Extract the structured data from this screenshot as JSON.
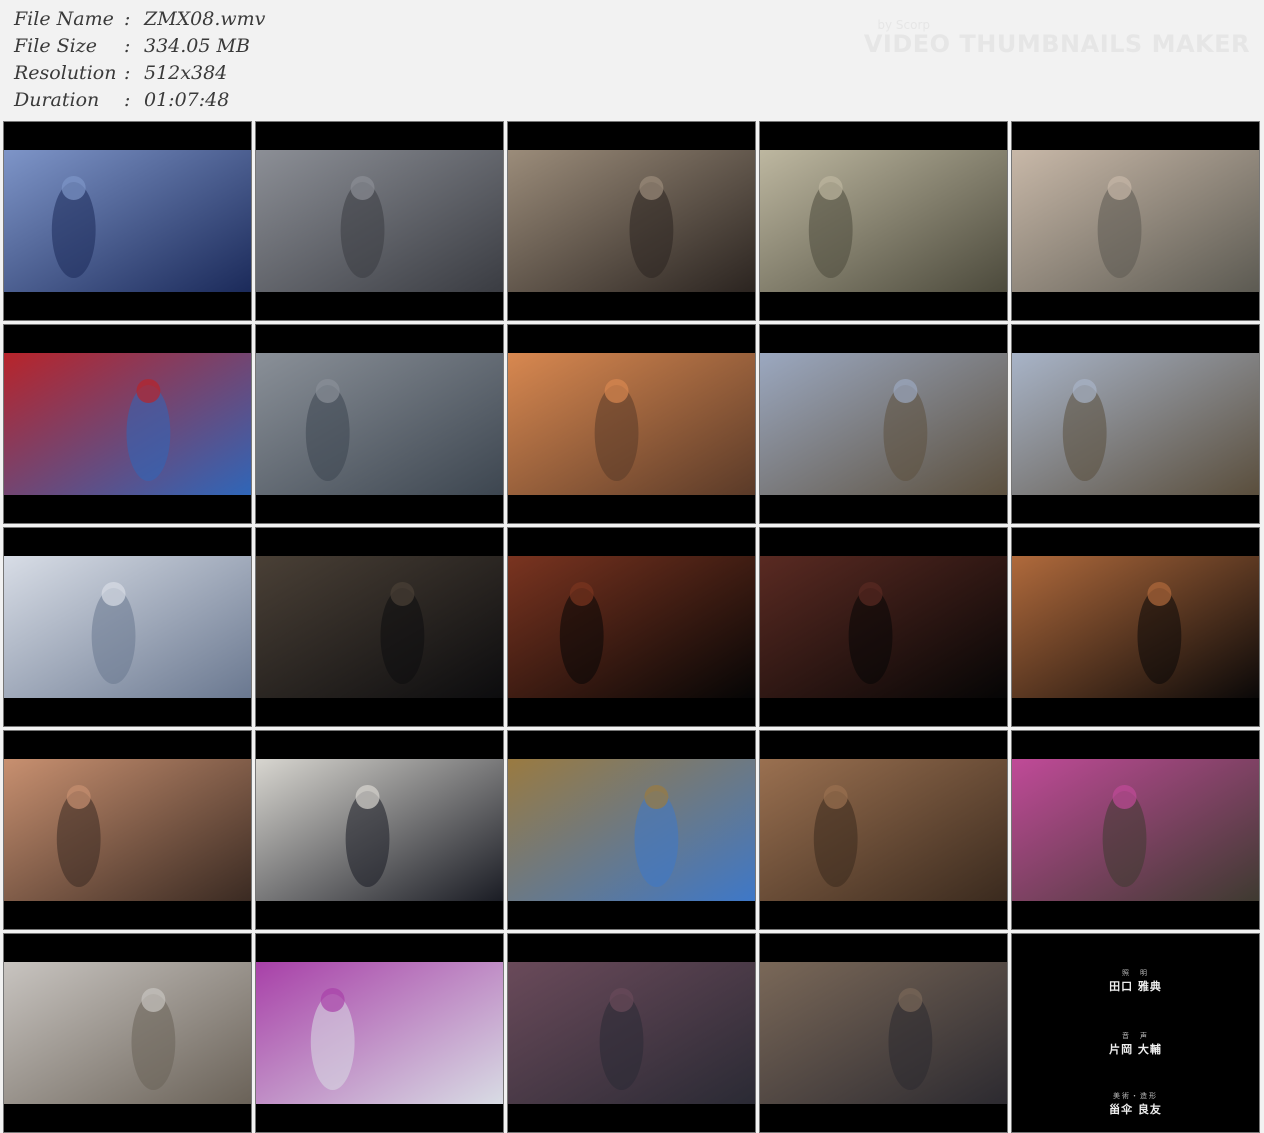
{
  "info": {
    "rows": [
      {
        "key": "File Name",
        "sep": ":",
        "value": "ZMX08.wmv"
      },
      {
        "key": "File Size",
        "sep": ":",
        "value": "334.05 MB"
      },
      {
        "key": "Resolution",
        "sep": ":",
        "value": "512x384"
      },
      {
        "key": "Duration",
        "sep": ":",
        "value": "01:07:48"
      }
    ]
  },
  "watermark": {
    "by": "by Scorp",
    "title": "VIDEO THUMBNAILS MAKER"
  },
  "thumbnails": [
    {
      "scene": "figure-in-blue-fog",
      "colors": [
        "#1b2a5a",
        "#7e95c8"
      ]
    },
    {
      "scene": "girls-in-classroom",
      "colors": [
        "#3a3c42",
        "#8c8f96"
      ]
    },
    {
      "scene": "girls-in-classroom",
      "colors": [
        "#2b2420",
        "#9b8c7a"
      ]
    },
    {
      "scene": "playground-equipment",
      "colors": [
        "#4c4a3c",
        "#bdb7a0"
      ]
    },
    {
      "scene": "girl-on-ground",
      "colors": [
        "#5c5a52",
        "#c8b8a8"
      ]
    },
    {
      "scene": "girl-blue-sky",
      "colors": [
        "#2f66b8",
        "#b8242a"
      ]
    },
    {
      "scene": "overhead-corridor",
      "colors": [
        "#3d4650",
        "#8a9098"
      ]
    },
    {
      "scene": "closeup-face",
      "colors": [
        "#5a3a28",
        "#d88850"
      ]
    },
    {
      "scene": "school-yard",
      "colors": [
        "#5c503e",
        "#9ba8c0"
      ]
    },
    {
      "scene": "school-yard",
      "colors": [
        "#5a4e3c",
        "#a8b4c8"
      ]
    },
    {
      "scene": "fight-outdoor",
      "colors": [
        "#6a7890",
        "#d8dde6"
      ]
    },
    {
      "scene": "night-yard",
      "colors": [
        "#0c0c0e",
        "#4a4036"
      ]
    },
    {
      "scene": "night-fight",
      "colors": [
        "#050505",
        "#7a3420"
      ]
    },
    {
      "scene": "night-fight",
      "colors": [
        "#050505",
        "#5a2a22"
      ]
    },
    {
      "scene": "girl-lying-dark",
      "colors": [
        "#0a0808",
        "#b06a3c"
      ]
    },
    {
      "scene": "closeup-headband",
      "colors": [
        "#3a2a22",
        "#c89070"
      ]
    },
    {
      "scene": "girl-sailor-uniform",
      "colors": [
        "#1a1c24",
        "#d8d6d0"
      ]
    },
    {
      "scene": "hill-sunset",
      "colors": [
        "#3e78c8",
        "#9a7a40"
      ]
    },
    {
      "scene": "man-closeup",
      "colors": [
        "#3a2a1e",
        "#9a7050"
      ]
    },
    {
      "scene": "girl-upside-down",
      "colors": [
        "#3e3a30",
        "#c04a98"
      ]
    },
    {
      "scene": "shrine-group",
      "colors": [
        "#6a6258",
        "#c8c4c0"
      ]
    },
    {
      "scene": "pink-hoodie",
      "colors": [
        "#d8dce4",
        "#a840a8"
      ]
    },
    {
      "scene": "classroom-group",
      "colors": [
        "#2a2a34",
        "#6a4a5a"
      ]
    },
    {
      "scene": "classroom-group",
      "colors": [
        "#2c2a30",
        "#7a6858"
      ]
    },
    {
      "scene": "credits",
      "colors": [
        "#000000",
        "#000000"
      ],
      "credits": [
        {
          "role": "照　明",
          "name": "田口 雅典"
        },
        {
          "role": "音　声",
          "name": "片岡 大輔"
        },
        {
          "role": "美術・造形",
          "name": "甾伞 良友"
        }
      ]
    }
  ]
}
